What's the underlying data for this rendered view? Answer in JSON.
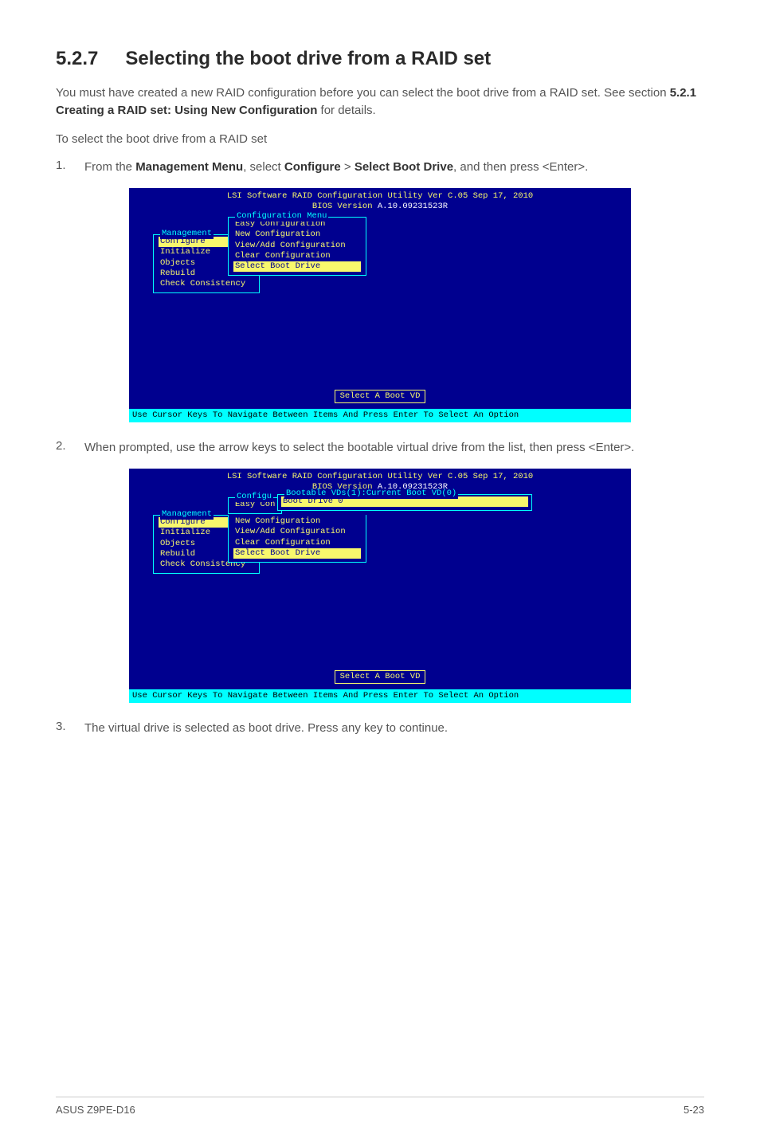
{
  "heading": {
    "num": "5.2.7",
    "title": "Selecting the boot drive from a RAID set"
  },
  "intro": "You must have created a new RAID configuration before you can select the boot drive from a RAID set. See section ",
  "intro_ref": "5.2.1 Creating a RAID set: Using New Configuration",
  "intro_tail": " for details.",
  "lead": "To select the boot drive from a RAID set",
  "steps": {
    "s1_num": "1.",
    "s1_a": "From the ",
    "s1_b": "Management Menu",
    "s1_c": ", select ",
    "s1_d": "Configure",
    "s1_e": " > ",
    "s1_f": "Select Boot Drive",
    "s1_g": ", and then press <Enter>.",
    "s2_num": "2.",
    "s2": "When prompted, use the arrow keys to select the bootable virtual drive from the list, then press <Enter>.",
    "s3_num": "3.",
    "s3": "The virtual drive is selected as boot drive. Press any key to continue."
  },
  "bios": {
    "title1": "LSI Software RAID Configuration Utility Ver C.05 Sep 17, 2010",
    "title2a": "BIOS Version ",
    "title2b": "A.10.09231523R",
    "mgmt_legend": "Management ",
    "mgmt_items": [
      "Configure",
      "Initialize",
      "Objects",
      "Rebuild",
      "Check Consistency"
    ],
    "cfg_legend": "Configuration Menu",
    "cfg_items": [
      "Easy Configuration",
      "New Configuration",
      "View/Add Configuration",
      "Clear Configuration",
      "Select Boot Drive"
    ],
    "hint": "Select A Boot VD",
    "status": "Use Cursor Keys To Navigate Between Items And Press Enter To Select An Option",
    "cfg2_legend": "Configu",
    "easy_con": "Easy Con",
    "boot_legend": "Bootable VDs(1):Current Boot VD(0)",
    "boot_item": "Boot Drive 0"
  },
  "footer": {
    "left": "ASUS Z9PE-D16",
    "right": "5-23"
  },
  "chart_data": {
    "type": "table",
    "note": "no quantitative chart present"
  }
}
